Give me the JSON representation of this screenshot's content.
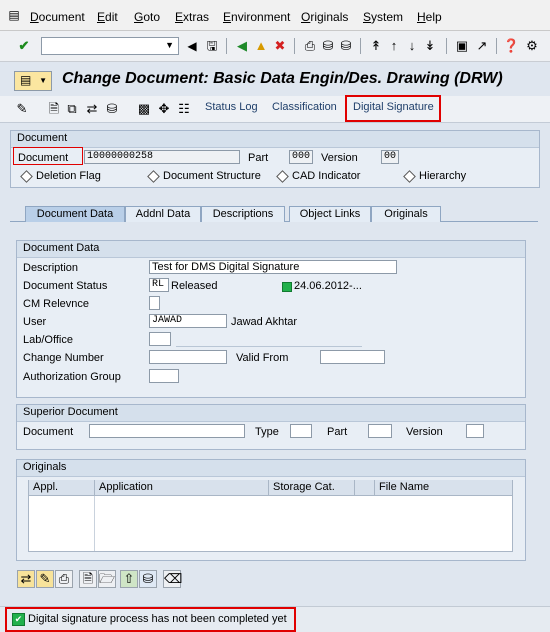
{
  "menu": {
    "items": [
      "Document",
      "Edit",
      "Goto",
      "Extras",
      "Environment",
      "Originals",
      "System",
      "Help"
    ]
  },
  "title": "Change Document: Basic Data Engin/Des. Drawing (DRW)",
  "app_toolbar": {
    "status_log": "Status Log",
    "classification": "Classification",
    "digital_signature": "Digital Signature"
  },
  "document_group": {
    "title": "Document",
    "document_label": "Document",
    "document_value": "10000000258",
    "part_label": "Part",
    "part_value": "000",
    "version_label": "Version",
    "version_value": "00",
    "deletion_flag": "Deletion Flag",
    "document_structure": "Document Structure",
    "cad_indicator": "CAD Indicator",
    "hierarchy": "Hierarchy"
  },
  "tabs": [
    "Document Data",
    "Addnl Data",
    "Descriptions",
    "Object Links",
    "Originals"
  ],
  "document_data": {
    "title": "Document Data",
    "description_label": "Description",
    "description_value": "Test for DMS Digital Signature",
    "status_label": "Document Status",
    "status_code": "RL",
    "status_text": "Released",
    "status_date": "24.06.2012-...",
    "cm_label": "CM Relevnce",
    "user_label": "User",
    "user_value": "JAWAD",
    "user_name": "Jawad Akhtar",
    "lab_label": "Lab/Office",
    "change_number_label": "Change Number",
    "valid_from_label": "Valid From",
    "auth_group_label": "Authorization Group"
  },
  "superior_document": {
    "title": "Superior Document",
    "document_label": "Document",
    "type_label": "Type",
    "part_label": "Part",
    "version_label": "Version"
  },
  "originals": {
    "title": "Originals",
    "columns": [
      "Appl.",
      "Application",
      "Storage Cat.",
      "",
      "File Name"
    ]
  },
  "status_bar": {
    "message": "Digital signature process has not been completed yet"
  },
  "colors": {
    "highlight_red": "#e00000",
    "status_green": "#22b14c",
    "background": "#dfe6ef"
  }
}
